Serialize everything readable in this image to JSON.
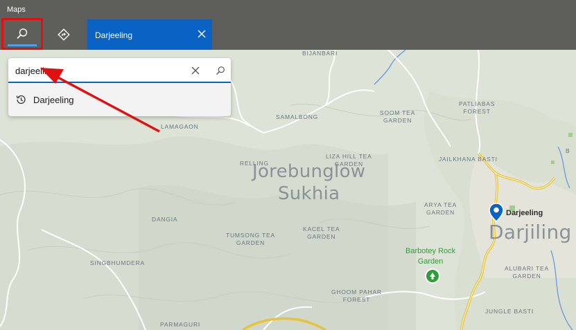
{
  "app": {
    "title": "Maps"
  },
  "toolbar": {
    "search_icon": "search-icon",
    "directions_icon": "directions-icon",
    "tab": {
      "label": "Darjeeling",
      "close_icon": "close-icon"
    }
  },
  "search": {
    "value": "darjeeling",
    "clear_icon": "close-icon",
    "submit_icon": "search-icon",
    "suggestions": [
      {
        "icon": "history-icon",
        "label": "Darjeeling"
      }
    ]
  },
  "map": {
    "places": [
      {
        "text": "BIJANBARI"
      },
      {
        "text": "SAMALBONG"
      },
      {
        "text": "SOOM TEA\nGARDEN"
      },
      {
        "text": "PATLIABAS\nFOREST"
      },
      {
        "text": "LAMAGAON"
      },
      {
        "text": "JAILKHANA BASTI"
      },
      {
        "text": "LIZA HILL TEA\nGARDEN"
      },
      {
        "text": "RELLING"
      },
      {
        "text": "ARYA TEA\nGARDEN"
      },
      {
        "text": "DANGIA"
      },
      {
        "text": "TUMSONG TEA\nGARDEN"
      },
      {
        "text": "KACEL TEA\nGARDEN"
      },
      {
        "text": "SINGBHUMDERA"
      },
      {
        "text": "ALUBARI TEA\nGARDEN"
      },
      {
        "text": "GHOOM PAHAR\nFOREST"
      },
      {
        "text": "JUNGLE BASTI"
      },
      {
        "text": "PARMAGURI"
      },
      {
        "text": "B"
      }
    ],
    "regions": [
      {
        "text": "Jorebunglow\nSukhia"
      },
      {
        "text": "Darjiling"
      }
    ],
    "poi": {
      "text": "Barbotey Rock\nGarden",
      "icon": "tree-icon",
      "color": "#2f9e3a"
    },
    "pin": {
      "label": "Darjeeling",
      "icon": "location-pin-icon",
      "color": "#0a62c4"
    }
  },
  "colors": {
    "titlebar": "#5e5e5b",
    "accent": "#0a62c4",
    "highlight": "#e01010",
    "map_land": "#dde3d6",
    "road_major": "#f2d24a"
  }
}
